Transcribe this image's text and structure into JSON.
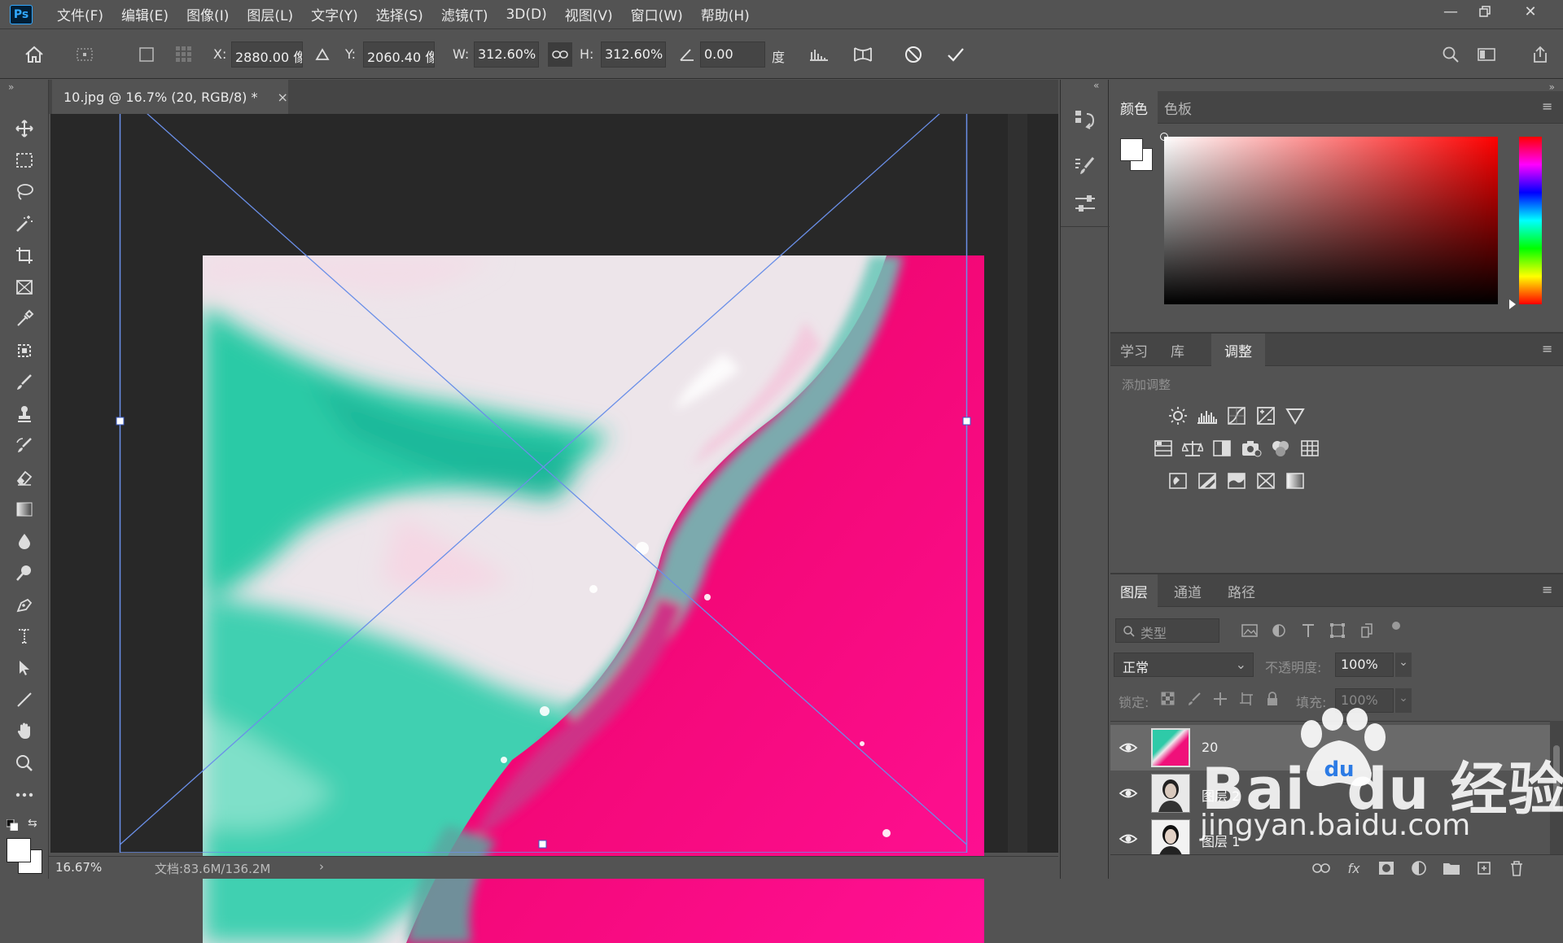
{
  "app": {
    "logo": "Ps"
  },
  "menu": [
    "文件(F)",
    "编辑(E)",
    "图像(I)",
    "图层(L)",
    "文字(Y)",
    "选择(S)",
    "滤镜(T)",
    "3D(D)",
    "视图(V)",
    "窗口(W)",
    "帮助(H)"
  ],
  "options": {
    "x_label": "X:",
    "x_value": "2880.00 像",
    "y_label": "Y:",
    "y_value": "2060.40 像",
    "w_label": "W:",
    "w_value": "312.60%",
    "h_label": "H:",
    "h_value": "312.60%",
    "angle_value": "0.00",
    "angle_unit": "度"
  },
  "document": {
    "tab_title": "10.jpg @ 16.7% (20, RGB/8) *",
    "close": "×"
  },
  "status": {
    "zoom": "16.67%",
    "doc_size": "文档:83.6M/136.2M",
    "arrow": "›"
  },
  "color_panel": {
    "tabs": [
      "颜色",
      "色板"
    ],
    "active": 0
  },
  "adjust_panel": {
    "tabs": [
      "学习",
      "库",
      "调整"
    ],
    "active": 2,
    "add_label": "添加调整"
  },
  "layers_panel": {
    "tabs": [
      "图层",
      "通道",
      "路径"
    ],
    "active": 0,
    "filter_placeholder": "类型",
    "blend_mode": "正常",
    "opacity_label": "不透明度:",
    "opacity_value": "100%",
    "lock_label": "锁定:",
    "fill_label": "填充:",
    "fill_value": "100%",
    "layers": [
      {
        "name": "20",
        "selected": true
      },
      {
        "name": "图层 2",
        "selected": false
      },
      {
        "name": "图层 1",
        "selected": false
      }
    ]
  },
  "watermark": {
    "brand": "Bai  du 经验",
    "url": "jingyan.baidu.com"
  },
  "colors": {
    "bg": "#535353",
    "canvas": "#282828",
    "accent": "#31a8ff",
    "pink": "#f0107a",
    "teal": "#2ec9a8"
  }
}
